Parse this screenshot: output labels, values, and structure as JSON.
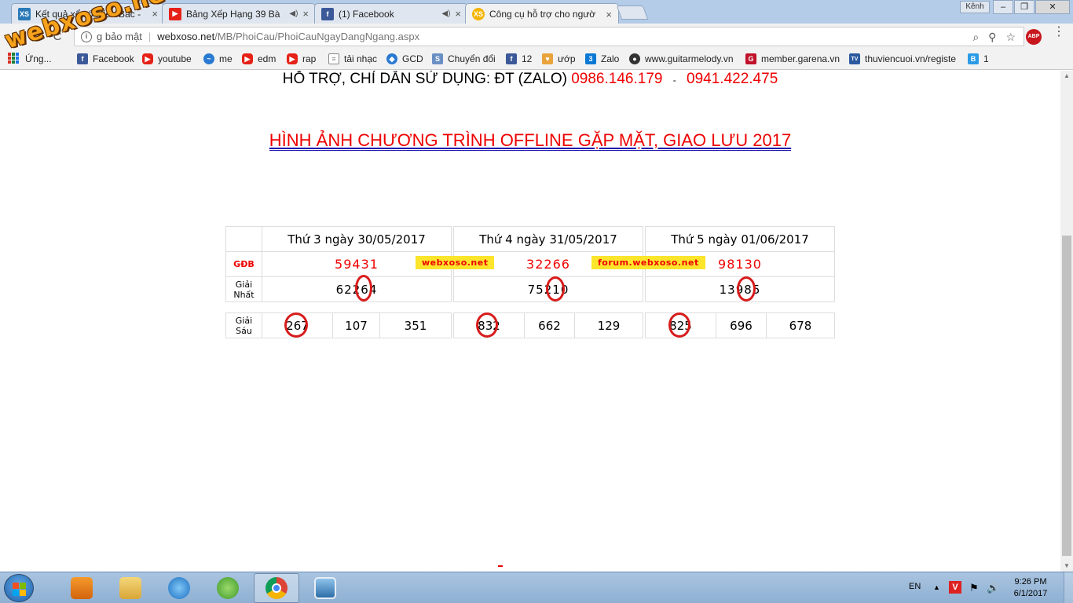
{
  "tabs": [
    {
      "title": "Kết quả xổ số Miền Bắc -",
      "favicon_text": "XS",
      "favicon_color": "#2a7ab8",
      "close": "×"
    },
    {
      "title": "Bảng Xếp Hạng 39 Bà",
      "favicon_text": "▶",
      "favicon_color": "#e62117",
      "speaker": "◀)",
      "close": "×"
    },
    {
      "title": "(1) Facebook",
      "favicon_text": "f",
      "favicon_color": "#3b5998",
      "speaker": "◀)",
      "close": "×"
    },
    {
      "title": "Công cụ hỗ trợ cho ngườ",
      "favicon_text": "XS",
      "favicon_color": "#f4b400",
      "close": "×"
    }
  ],
  "window": {
    "kenh_label": "Kênh",
    "minimize": "–",
    "restore": "❐",
    "close": "✕"
  },
  "toolbar": {
    "back": "←",
    "forward": "→",
    "reload": "C",
    "security_label": "g bảo mật",
    "host": "webxoso.net",
    "path": "/MB/PhoiCau/PhoiCauNgayDangNgang.aspx",
    "zoom_icon": "⌕",
    "ext_icon": "⚲",
    "star": "☆",
    "abp": "ABP",
    "menu": "⋮"
  },
  "bookmarks": [
    {
      "label": "Ứng...",
      "icon": "apps-icon"
    },
    {
      "label": "Facebook",
      "icon": "facebook-icon",
      "badge": "f"
    },
    {
      "label": "youtube",
      "icon": "youtube-icon",
      "badge": "▶"
    },
    {
      "label": "me",
      "icon": "link-icon",
      "badge": "~"
    },
    {
      "label": "edm",
      "icon": "youtube-icon",
      "badge": "▶"
    },
    {
      "label": "rap",
      "icon": "youtube-icon",
      "badge": "▶"
    },
    {
      "label": "tải nhạc",
      "icon": "page-icon",
      "badge": "≡"
    },
    {
      "label": "GCD",
      "icon": "drop-icon",
      "badge": "◆"
    },
    {
      "label": "Chuyển đổi",
      "icon": "swap-icon",
      "badge": "S"
    },
    {
      "label": "12",
      "icon": "facebook-icon",
      "badge": "f"
    },
    {
      "label": "ướp",
      "icon": "heart-icon",
      "badge": "♥"
    },
    {
      "label": "Zalo",
      "icon": "zalo-icon",
      "badge": "3"
    },
    {
      "label": "www.guitarmelody.vn",
      "icon": "globe-icon",
      "badge": "●"
    },
    {
      "label": "member.garena.vn",
      "icon": "garena-icon",
      "badge": "G"
    },
    {
      "label": "thuviencuoi.vn/registe",
      "icon": "tv-icon",
      "badge": "TV"
    },
    {
      "label": "1",
      "icon": "b-icon",
      "badge": "B"
    }
  ],
  "logo": "webxoso.net",
  "content": {
    "support_text": "HỖ TRỢ, CHỈ DẪN SỬ DỤNG: ĐT (ZALO)",
    "phone1": "0986.146.179",
    "dash": "-",
    "phone2": "0941.422.475",
    "offline_link": "HÌNH ẢNH CHƯƠNG TRÌNH OFFLINE GẶP MẶT, GIAO LƯU 2017"
  },
  "lottery": {
    "days": [
      "Thứ 3 ngày 30/05/2017",
      "Thứ 4 ngày 31/05/2017",
      "Thứ 5 ngày 01/06/2017"
    ],
    "gdb_label": "GĐB",
    "gdb": [
      "59431",
      "32266",
      "98130"
    ],
    "badge1": "webxoso.net",
    "badge2": "forum.webxoso.net",
    "nhat_label_1": "Giải",
    "nhat_label_2": "Nhất",
    "nhat": [
      "62264",
      "75210",
      "13985"
    ],
    "sau_label_1": "Giải",
    "sau_label_2": "Sáu",
    "sau": [
      [
        "267",
        "107",
        "351"
      ],
      [
        "832",
        "662",
        "129"
      ],
      [
        "825",
        "696",
        "678"
      ]
    ]
  },
  "taskbar": {
    "apps": [
      "media-player",
      "file-explorer",
      "internet-explorer",
      "coccoc",
      "chrome",
      "photo-viewer"
    ],
    "lang": "EN",
    "tray_up": "▲",
    "v_icon": "V",
    "flag": "⚑",
    "volume": "🔊",
    "time": "9:26 PM",
    "date": "6/1/2017"
  }
}
